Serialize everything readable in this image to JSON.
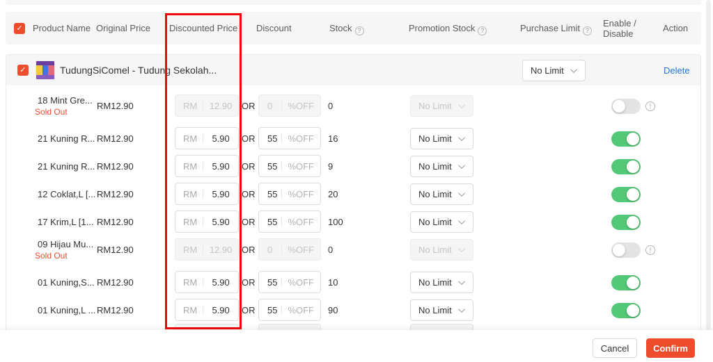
{
  "colors": {
    "accent": "#ee4d2d",
    "link": "#2673dd",
    "toggle_on": "#53c876",
    "annotation": "#f40606",
    "sold_out": "#ee4d2d"
  },
  "header": {
    "product_name": "Product Name",
    "original_price": "Original Price",
    "discounted_price": "Discounted Price",
    "discount": "Discount",
    "stock": "Stock",
    "promotion_stock": "Promotion Stock",
    "purchase_limit": "Purchase Limit",
    "enable_disable_line1": "Enable /",
    "enable_disable_line2": "Disable",
    "action": "Action"
  },
  "labels": {
    "or": "OR",
    "currency": "RM",
    "percent_off": "%OFF",
    "sold_out": "Sold Out",
    "check": "✓"
  },
  "product": {
    "title": "TudungSiComel - Tudung Sekolah...",
    "purchase_limit_value": "No Limit",
    "delete_label": "Delete"
  },
  "rows": [
    {
      "name": "18 Mint Gre...",
      "sold_out": true,
      "original_price": "RM12.90",
      "discounted_price": "12.90",
      "discount": "0",
      "stock": "0",
      "purchase_limit": "No Limit",
      "enabled": false
    },
    {
      "name": "21 Kuning R...",
      "sold_out": false,
      "original_price": "RM12.90",
      "discounted_price": "5.90",
      "discount": "55",
      "stock": "16",
      "purchase_limit": "No Limit",
      "enabled": true
    },
    {
      "name": "21 Kuning R...",
      "sold_out": false,
      "original_price": "RM12.90",
      "discounted_price": "5.90",
      "discount": "55",
      "stock": "9",
      "purchase_limit": "No Limit",
      "enabled": true
    },
    {
      "name": "12 Coklat,L [...",
      "sold_out": false,
      "original_price": "RM12.90",
      "discounted_price": "5.90",
      "discount": "55",
      "stock": "20",
      "purchase_limit": "No Limit",
      "enabled": true
    },
    {
      "name": "17 Krim,L [1...",
      "sold_out": false,
      "original_price": "RM12.90",
      "discounted_price": "5.90",
      "discount": "55",
      "stock": "100",
      "purchase_limit": "No Limit",
      "enabled": true
    },
    {
      "name": "09 Hijau Mu...",
      "sold_out": true,
      "original_price": "RM12.90",
      "discounted_price": "12.90",
      "discount": "0",
      "stock": "0",
      "purchase_limit": "No Limit",
      "enabled": false
    },
    {
      "name": "01 Kuning,S...",
      "sold_out": false,
      "original_price": "RM12.90",
      "discounted_price": "5.90",
      "discount": "55",
      "stock": "10",
      "purchase_limit": "No Limit",
      "enabled": true
    },
    {
      "name": "01 Kuning,L ...",
      "sold_out": false,
      "original_price": "RM12.90",
      "discounted_price": "5.90",
      "discount": "55",
      "stock": "90",
      "purchase_limit": "No Limit",
      "enabled": true
    }
  ],
  "footer": {
    "cancel_label": "Cancel",
    "confirm_label": "Confirm"
  }
}
